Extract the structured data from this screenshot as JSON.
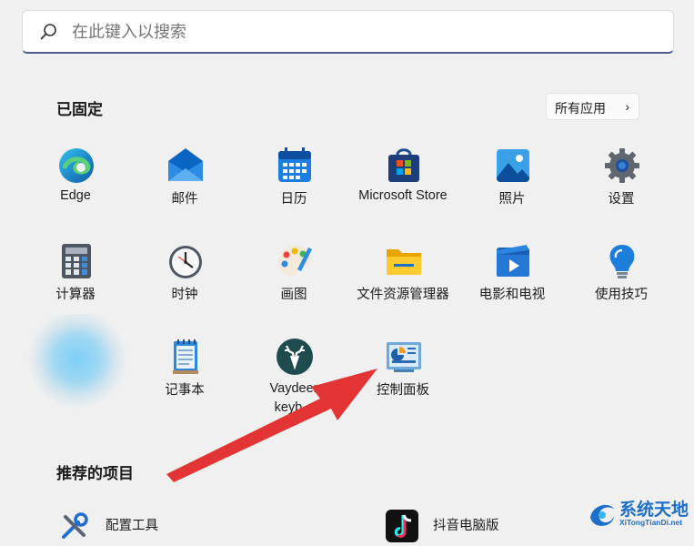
{
  "search": {
    "placeholder": "在此键入以搜索",
    "icon": "search-icon"
  },
  "pinned": {
    "title": "已固定",
    "all_apps_label": "所有应用",
    "all_apps_chevron": "›",
    "apps": [
      {
        "label": "Edge",
        "icon": "edge-icon"
      },
      {
        "label": "邮件",
        "icon": "mail-icon"
      },
      {
        "label": "日历",
        "icon": "calendar-icon"
      },
      {
        "label": "Microsoft Store",
        "icon": "store-icon"
      },
      {
        "label": "照片",
        "icon": "photos-icon"
      },
      {
        "label": "设置",
        "icon": "settings-gear-icon"
      },
      {
        "label": "计算器",
        "icon": "calculator-icon"
      },
      {
        "label": "时钟",
        "icon": "clock-icon"
      },
      {
        "label": "画图",
        "icon": "paint-palette-icon"
      },
      {
        "label": "文件资源管理器",
        "icon": "folder-icon"
      },
      {
        "label": "电影和电视",
        "icon": "movies-tv-icon"
      },
      {
        "label": "使用技巧",
        "icon": "tips-lightbulb-icon"
      },
      {
        "label": "记事本",
        "icon": "notepad-icon"
      },
      {
        "label": "Vaydeer keyb...",
        "icon": "vaydeer-deer-icon"
      },
      {
        "label": "控制面板",
        "icon": "control-panel-icon"
      }
    ]
  },
  "recommended": {
    "title": "推荐的项目",
    "items": [
      {
        "label": "配置工具",
        "icon": "tools-icon"
      },
      {
        "label": "抖音电脑版",
        "icon": "douyin-icon"
      }
    ]
  },
  "watermark": {
    "title": "系统天地",
    "subtitle": "XiTongTianDi.net"
  },
  "colors": {
    "accent": "#4f5b8f",
    "arrow": "#e23434",
    "background": "#f0f0f0"
  }
}
